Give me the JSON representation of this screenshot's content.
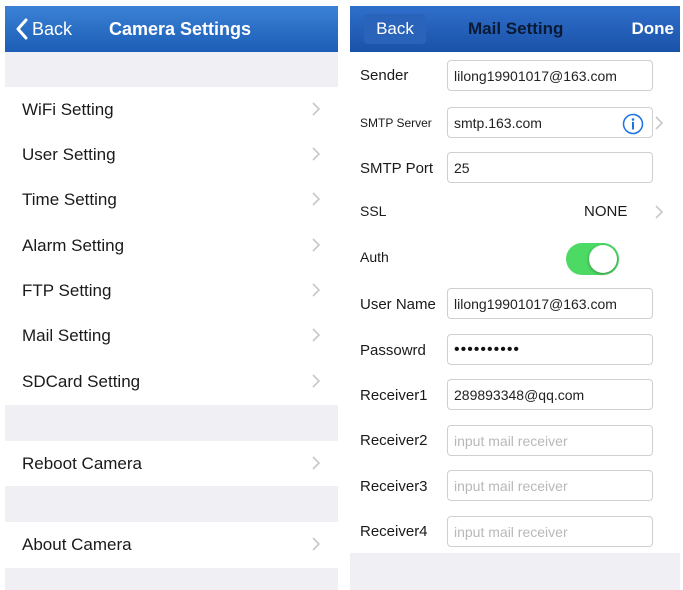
{
  "camera_settings": {
    "back_label": "Back",
    "title": "Camera Settings",
    "items": [
      {
        "label": "WiFi Setting"
      },
      {
        "label": "User Setting"
      },
      {
        "label": "Time Setting"
      },
      {
        "label": "Alarm Setting"
      },
      {
        "label": "FTP Setting"
      },
      {
        "label": "Mail Setting"
      },
      {
        "label": "SDCard Setting"
      }
    ],
    "reboot_label": "Reboot Camera",
    "about_label": "About Camera"
  },
  "mail_setting": {
    "back_label": "Back",
    "title": "Mail Setting",
    "done_label": "Done",
    "sender_label": "Sender",
    "sender_value": "lilong19901017@163.com",
    "smtp_server_label": "SMTP Server",
    "smtp_server_value": "smtp.163.com",
    "smtp_port_label": "SMTP Port",
    "smtp_port_value": "25",
    "ssl_label": "SSL",
    "ssl_value": "NONE",
    "auth_label": "Auth",
    "auth_enabled": true,
    "username_label": "User Name",
    "username_value": "lilong19901017@163.com",
    "password_label": "Passowrd",
    "password_value": "••••••••••",
    "receiver1_label": "Receiver1",
    "receiver1_value": "289893348@qq.com",
    "receiver2_label": "Receiver2",
    "receiver3_label": "Receiver3",
    "receiver4_label": "Receiver4",
    "receiver_placeholder": "input mail receiver"
  },
  "colors": {
    "nav_blue": "#1c5db5",
    "toggle_on": "#4cd964",
    "group_gray": "#efeff4"
  }
}
